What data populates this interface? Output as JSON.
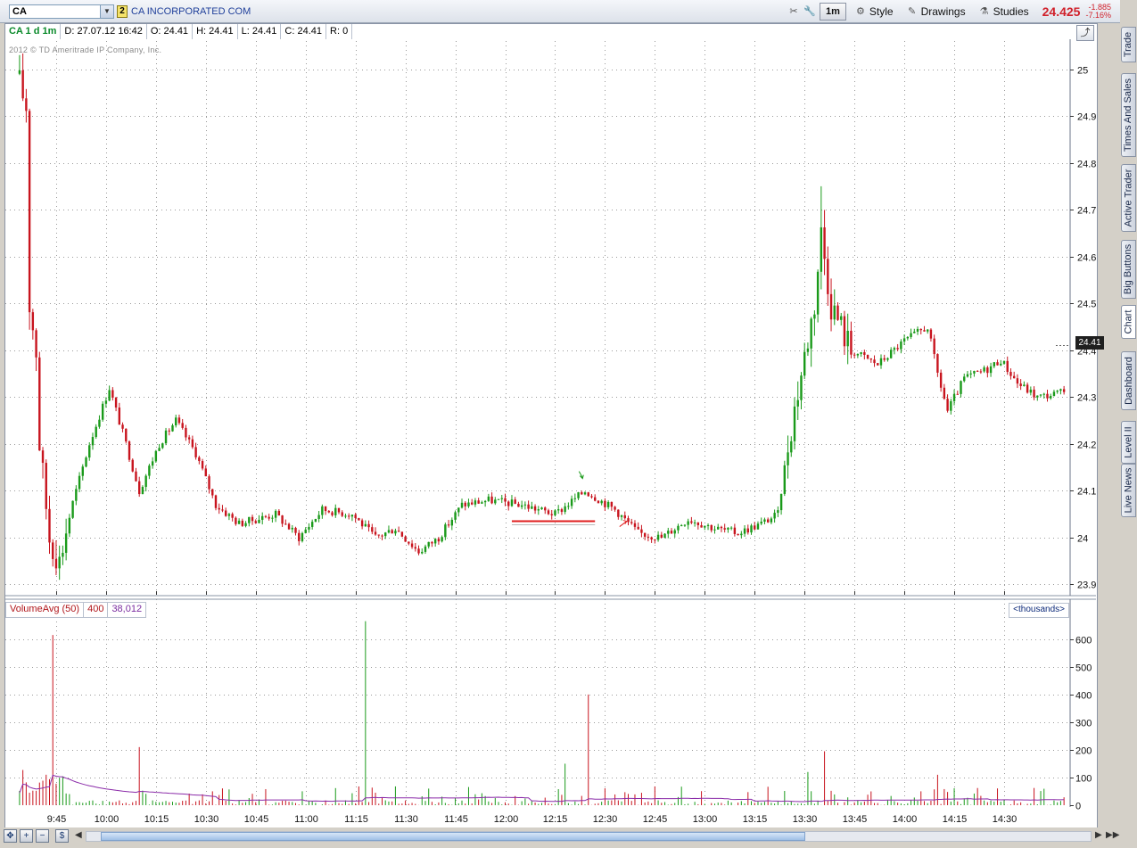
{
  "toolbar": {
    "symbol": "CA",
    "link_number": "2",
    "company": "CA INCORPORATED COM",
    "interval_button": "1m",
    "style_label": "Style",
    "drawings_label": "Drawings",
    "studies_label": "Studies",
    "last_price": "24.425",
    "net_change": "-1.885",
    "pct_change": "-7.16%"
  },
  "info": {
    "symbol_interval": "CA 1 d 1m",
    "date": "D: 27.07.12 16:42",
    "open": "O: 24.41",
    "high": "H: 24.41",
    "low": "L: 24.41",
    "close": "C: 24.41",
    "range": "R: 0"
  },
  "copyright": "2012 © TD Ameritrade IP Company, Inc.",
  "last_price_marker": "24.41",
  "volume": {
    "study_label": "VolumeAvg (50)",
    "volume_value": "400",
    "avg_value": "38,012",
    "units_label": "<thousands>"
  },
  "side_tabs": [
    "Trade",
    "Times And Sales",
    "Active Trader",
    "Big Buttons",
    "Chart",
    "Dashboard",
    "Level II",
    "Live News"
  ],
  "colors": {
    "up": "#1a9a1a",
    "down": "#c8141e",
    "avg_line": "#8a2aa8",
    "price_text": "#d0202a"
  },
  "chart_data": {
    "type": "candlestick",
    "time_ticks": [
      "9:45",
      "10:00",
      "10:15",
      "10:30",
      "10:45",
      "11:00",
      "11:15",
      "11:30",
      "11:45",
      "12:00",
      "12:15",
      "12:30",
      "12:45",
      "13:00",
      "13:15",
      "13:30",
      "13:45",
      "14:00",
      "14:15",
      "14:30"
    ],
    "price_ticks": [
      25,
      24.9,
      24.8,
      24.7,
      24.6,
      24.5,
      24.4,
      24.3,
      24.2,
      24.1,
      24,
      23.9
    ],
    "price_range": [
      23.88,
      25.06
    ],
    "volume_ticks": [
      0,
      100,
      200,
      300,
      400,
      500,
      600
    ],
    "volume_range": [
      0,
      680
    ],
    "volume_units": "thousands",
    "grid": true,
    "close_anchors": [
      {
        "t": "9:34",
        "p": 24.97
      },
      {
        "t": "9:36",
        "p": 24.92
      },
      {
        "t": "9:37",
        "p": 24.5
      },
      {
        "t": "9:39",
        "p": 24.4
      },
      {
        "t": "9:40",
        "p": 24.2
      },
      {
        "t": "9:43",
        "p": 24.0
      },
      {
        "t": "9:46",
        "p": 23.95
      },
      {
        "t": "9:49",
        "p": 24.05
      },
      {
        "t": "9:55",
        "p": 24.2
      },
      {
        "t": "10:01",
        "p": 24.32
      },
      {
        "t": "10:06",
        "p": 24.2
      },
      {
        "t": "10:10",
        "p": 24.1
      },
      {
        "t": "10:16",
        "p": 24.2
      },
      {
        "t": "10:21",
        "p": 24.25
      },
      {
        "t": "10:27",
        "p": 24.18
      },
      {
        "t": "10:33",
        "p": 24.07
      },
      {
        "t": "10:40",
        "p": 24.03
      },
      {
        "t": "10:51",
        "p": 24.05
      },
      {
        "t": "10:58",
        "p": 24.0
      },
      {
        "t": "11:05",
        "p": 24.06
      },
      {
        "t": "11:14",
        "p": 24.05
      },
      {
        "t": "11:21",
        "p": 24.0
      },
      {
        "t": "11:27",
        "p": 24.02
      },
      {
        "t": "11:34",
        "p": 23.97
      },
      {
        "t": "11:40",
        "p": 24.0
      },
      {
        "t": "11:47",
        "p": 24.07
      },
      {
        "t": "11:55",
        "p": 24.08
      },
      {
        "t": "12:05",
        "p": 24.07
      },
      {
        "t": "12:15",
        "p": 24.05
      },
      {
        "t": "12:24",
        "p": 24.1
      },
      {
        "t": "12:33",
        "p": 24.06
      },
      {
        "t": "12:40",
        "p": 24.01
      },
      {
        "t": "12:47",
        "p": 24.0
      },
      {
        "t": "12:55",
        "p": 24.04
      },
      {
        "t": "13:03",
        "p": 24.02
      },
      {
        "t": "13:10",
        "p": 24.01
      },
      {
        "t": "13:17",
        "p": 24.03
      },
      {
        "t": "13:22",
        "p": 24.05
      },
      {
        "t": "13:25",
        "p": 24.2
      },
      {
        "t": "13:29",
        "p": 24.35
      },
      {
        "t": "13:33",
        "p": 24.5
      },
      {
        "t": "13:35",
        "p": 24.65
      },
      {
        "t": "13:38",
        "p": 24.5
      },
      {
        "t": "13:44",
        "p": 24.4
      },
      {
        "t": "13:52",
        "p": 24.37
      },
      {
        "t": "14:00",
        "p": 24.42
      },
      {
        "t": "14:07",
        "p": 24.45
      },
      {
        "t": "14:10",
        "p": 24.35
      },
      {
        "t": "14:13",
        "p": 24.27
      },
      {
        "t": "14:18",
        "p": 24.34
      },
      {
        "t": "14:25",
        "p": 24.36
      },
      {
        "t": "14:29",
        "p": 24.38
      },
      {
        "t": "14:34",
        "p": 24.33
      },
      {
        "t": "14:40",
        "p": 24.3
      },
      {
        "t": "14:48",
        "p": 24.31
      }
    ],
    "volume_spikes": [
      {
        "t": "9:44",
        "v": 615
      },
      {
        "t": "10:10",
        "v": 210
      },
      {
        "t": "11:18",
        "v": 665
      },
      {
        "t": "12:25",
        "v": 400
      },
      {
        "t": "13:36",
        "v": 195
      },
      {
        "t": "12:18",
        "v": 150
      },
      {
        "t": "13:31",
        "v": 120
      },
      {
        "t": "14:10",
        "v": 110
      }
    ],
    "annotations": [
      {
        "type": "horizontal-line",
        "t_start": "12:02",
        "t_end": "12:27",
        "p": 24.035,
        "color": "#e01e1e"
      },
      {
        "type": "arrow",
        "t": "12:23",
        "p": 24.13,
        "color": "#1a9a1a"
      },
      {
        "type": "arrow",
        "t": "12:36",
        "p": 24.035,
        "color": "#e01e1e"
      }
    ]
  }
}
